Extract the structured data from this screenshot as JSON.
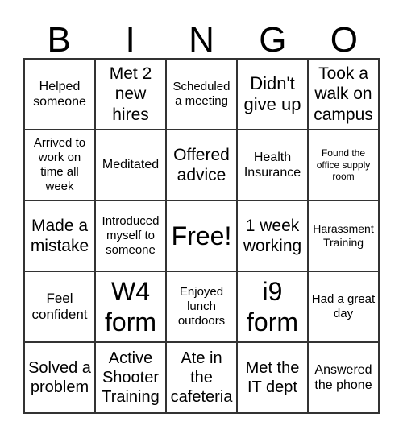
{
  "header": [
    "B",
    "I",
    "N",
    "G",
    "O"
  ],
  "cells": [
    {
      "text": "Helped someone",
      "size": 16
    },
    {
      "text": "Met 2 new hires",
      "size": 21
    },
    {
      "text": "Scheduled a meeting",
      "size": 15
    },
    {
      "text": "Didn't give up",
      "size": 22
    },
    {
      "text": "Took a walk on campus",
      "size": 21
    },
    {
      "text": "Arrived to work on time all week",
      "size": 15
    },
    {
      "text": "Meditated",
      "size": 16
    },
    {
      "text": "Offered advice",
      "size": 21
    },
    {
      "text": "Health Insurance",
      "size": 16
    },
    {
      "text": "Found the office supply room",
      "size": 12
    },
    {
      "text": "Made a mistake",
      "size": 21
    },
    {
      "text": "Introduced myself to someone",
      "size": 15
    },
    {
      "text": "Free!",
      "size": 32
    },
    {
      "text": "1 week working",
      "size": 21
    },
    {
      "text": "Harassment Training",
      "size": 14
    },
    {
      "text": "Feel confident",
      "size": 17
    },
    {
      "text": "W4 form",
      "size": 32
    },
    {
      "text": "Enjoyed lunch outdoors",
      "size": 15
    },
    {
      "text": "i9 form",
      "size": 32
    },
    {
      "text": "Had a great day",
      "size": 15
    },
    {
      "text": "Solved a problem",
      "size": 20
    },
    {
      "text": "Active Shooter Training",
      "size": 20
    },
    {
      "text": "Ate in the cafeteria",
      "size": 20
    },
    {
      "text": "Met the IT dept",
      "size": 20
    },
    {
      "text": "Answered the phone",
      "size": 16
    }
  ]
}
